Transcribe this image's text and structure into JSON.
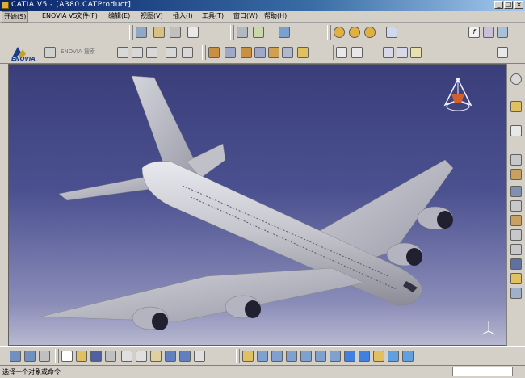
{
  "window": {
    "title": "CATIA V5 - [A380.CATProduct]",
    "min_label": "_",
    "max_label": "□",
    "close_label": "×"
  },
  "menubar": {
    "items": [
      {
        "label": "开始(S)",
        "active": true
      },
      {
        "label": "ENOVIA V5"
      },
      {
        "label": "文件(F)"
      },
      {
        "label": "编辑(E)"
      },
      {
        "label": "视图(V)"
      },
      {
        "label": "插入(I)"
      },
      {
        "label": "工具(T)"
      },
      {
        "label": "窗口(W)"
      },
      {
        "label": "帮助(H)"
      }
    ]
  },
  "toolbar2": {
    "logo_label": "ENOVIA",
    "search_label": "ENOVIA 搜索"
  },
  "statusbar": {
    "text": "选择一个对象或命令"
  },
  "icons": {
    "top_toolbar": [
      "product-icon",
      "component-icon",
      "constraint-icon",
      "snap-icon",
      "tree-icon",
      "manipulate-icon",
      "catalog-icon",
      "sun-icon",
      "sun-icon",
      "sun-icon",
      "formula-icon",
      "fx-icon",
      "knowledge-icon",
      "chain-icon"
    ],
    "view_toolbar": [
      "isometric-icon",
      "front-view-icon",
      "right-view-icon",
      "top-view-icon",
      "bottom-view-icon",
      "perspective-icon",
      "shading-icon",
      "cursor-icon",
      "pen-icon",
      "point-icon",
      "line-icon",
      "curve-icon"
    ],
    "right_toolbar": [
      "settings-icon",
      "selection-icon",
      "arrow-icon",
      "assembly-icon",
      "assembly-icon",
      "assembly-icon",
      "assembly-icon",
      "assembly-icon",
      "assembly-icon",
      "assembly-icon",
      "assembly-icon",
      "assembly-icon",
      "assembly-icon"
    ],
    "bottom_toolbar": [
      "new-icon",
      "open-icon",
      "save-icon",
      "print-icon",
      "cut-icon",
      "copy-icon",
      "paste-icon",
      "undo-icon",
      "redo-icon",
      "help-icon",
      "fly-icon",
      "fit-all-icon",
      "pan-icon",
      "rotate-icon",
      "zoom-in-icon",
      "zoom-out-icon",
      "normal-view-icon",
      "multi-view-icon",
      "views-icon",
      "shading-mode-icon",
      "hide-show-icon",
      "swap-space-icon"
    ]
  },
  "colors": {
    "titlebar": "#0a246a",
    "viewport_top": "#3a3e7a",
    "viewport_bottom": "#b8b8d0",
    "aircraft": "#c8c8d0",
    "chrome": "#d4d0c8"
  }
}
